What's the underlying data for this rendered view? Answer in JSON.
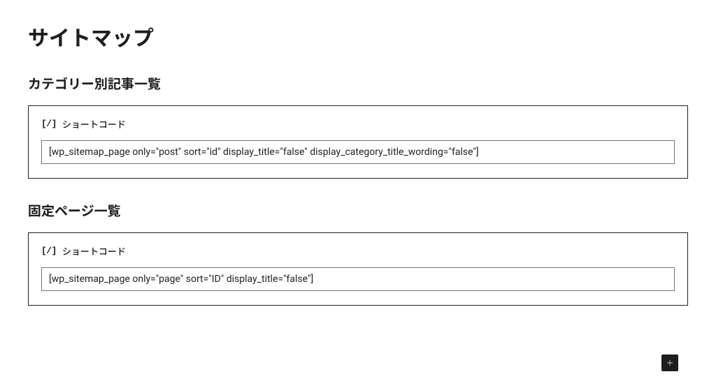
{
  "page_title": "サイトマップ",
  "sections": [
    {
      "heading": "カテゴリー別記事一覧",
      "shortcode_label": "ショートコード",
      "shortcode_value": "[wp_sitemap_page only=\"post\" sort=\"id\" display_title=\"false\" display_category_title_wording=\"false\"]"
    },
    {
      "heading": "固定ページ一覧",
      "shortcode_label": "ショートコード",
      "shortcode_value": "[wp_sitemap_page only=\"page\" sort=\"ID\" display_title=\"false\"]"
    }
  ],
  "icon_text": "[/]"
}
